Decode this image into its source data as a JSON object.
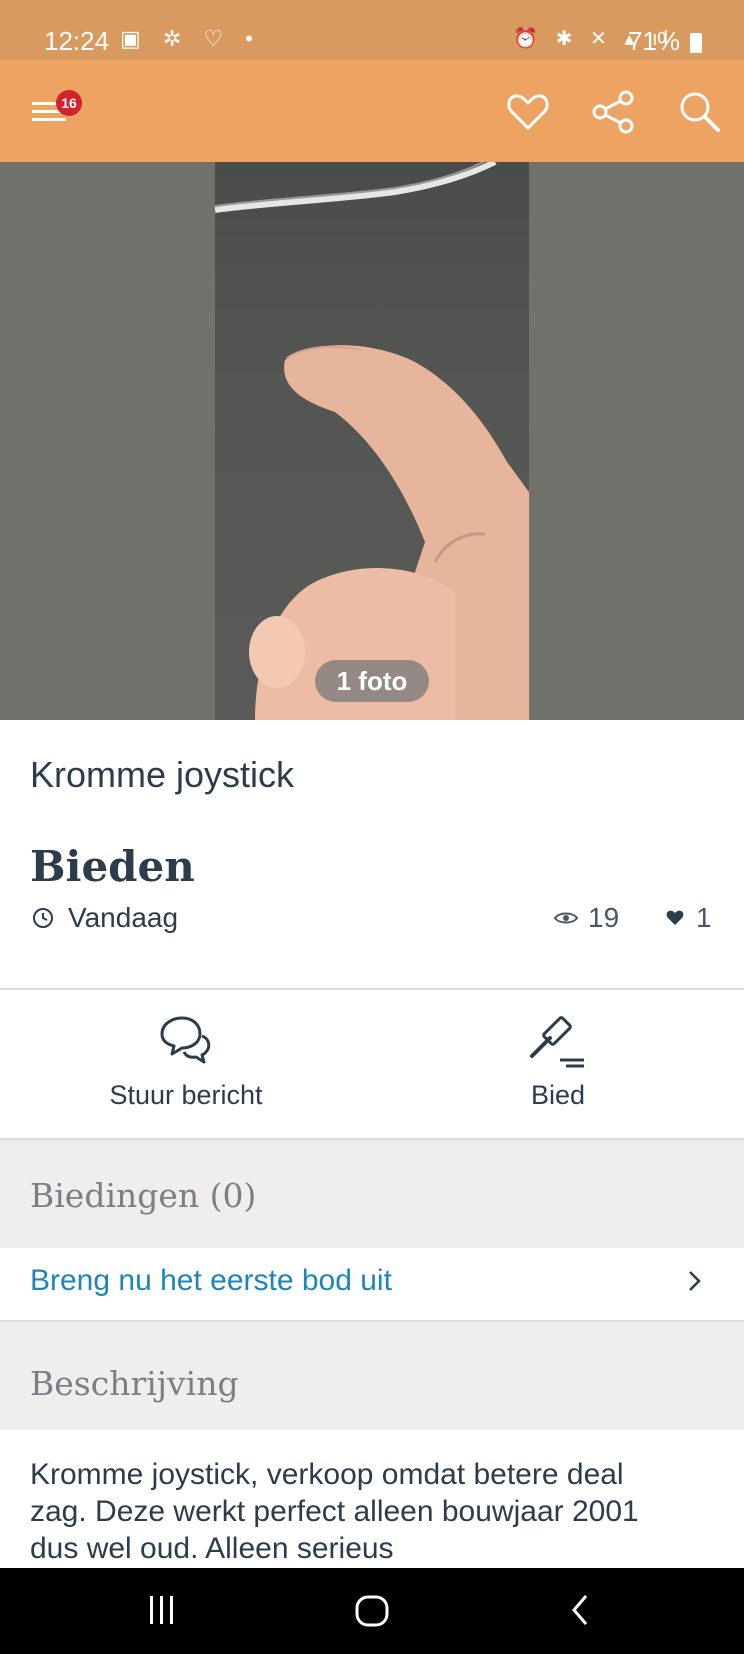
{
  "status_bar": {
    "time": "12:24",
    "battery": "71%"
  },
  "toolbar": {
    "menu_badge": "16"
  },
  "photo": {
    "count_label": "1 foto"
  },
  "listing": {
    "title": "Kromme joystick",
    "price": "Bieden",
    "date": "Vandaag",
    "views": "19",
    "favorites": "1"
  },
  "actions": {
    "message_label": "Stuur bericht",
    "bid_label": "Bied"
  },
  "bids": {
    "heading": "Biedingen (0)",
    "cta": "Breng nu het eerste bod uit"
  },
  "description": {
    "heading": "Beschrijving",
    "text": "Kromme joystick, verkoop omdat betere deal zag. Deze werkt perfect alleen bouwjaar 2001 dus wel oud. Alleen serieus"
  },
  "colors": {
    "toolbar": "#eda462",
    "status_bar": "#d89a5e",
    "badge": "#d0232f",
    "link": "#1f84b6"
  }
}
